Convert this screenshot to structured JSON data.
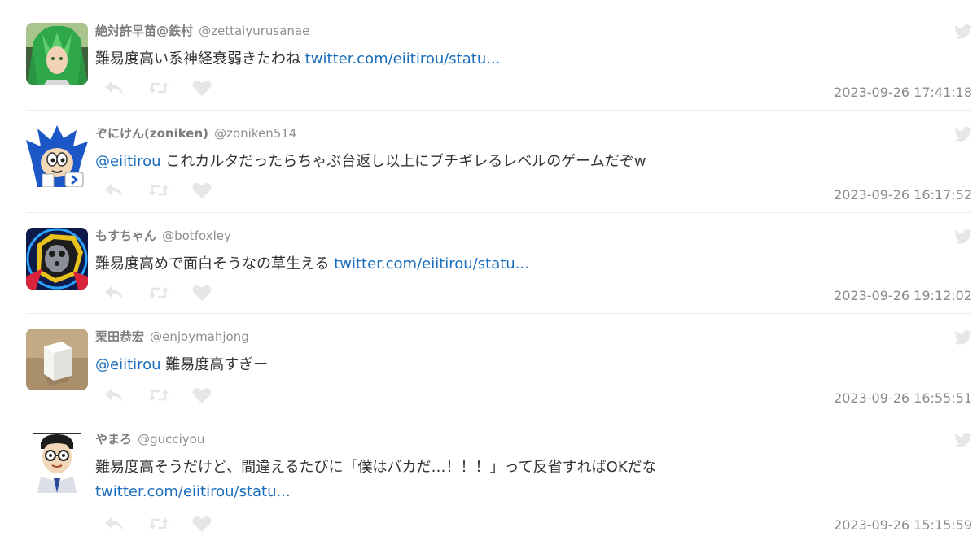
{
  "tweets": [
    {
      "display_name": "絶対許早苗@鉄村",
      "screen_name": "@zettaiyurusanae",
      "text": "難易度高い系神経衰弱きたわね ",
      "link": "twitter.com/eiitirou/statu...",
      "timestamp": "2023-09-26 17:41:18",
      "avatar": "green-haired-character-avatar"
    },
    {
      "display_name": "ぞにけん(zoniken)",
      "screen_name": "@zoniken514",
      "mention": "@eiitirou",
      "text": " これカルタだったらちゃぶ台返し以上にブチギレるレベルのゲームだぞw",
      "timestamp": "2023-09-26 16:17:52",
      "avatar": "blue-hedgehog-avatar"
    },
    {
      "display_name": "もすちゃん",
      "screen_name": "@botfoxley",
      "text": "難易度高めで面白そうなの草生える ",
      "link": "twitter.com/eiitirou/statu...",
      "timestamp": "2023-09-26 19:12:02",
      "avatar": "robot-mask-avatar"
    },
    {
      "display_name": "栗田恭宏",
      "screen_name": "@enjoymahjong",
      "mention": "@eiitirou",
      "text": " 難易度高すぎー",
      "timestamp": "2023-09-26 16:55:51",
      "avatar": "mahjong-tile-avatar"
    },
    {
      "display_name": "やまろ",
      "screen_name": "@gucciyou",
      "text": "難易度高そうだけど、間違えるたびに「僕はバカだ…！！！」って反省すればOKだな",
      "link": "twitter.com/eiitirou/statu...",
      "timestamp": "2023-09-26 15:15:59",
      "avatar": "glasses-man-avatar"
    }
  ],
  "colors": {
    "link": "#1a6ebd",
    "name": "#7c7c7c",
    "text": "#333333",
    "icon": "#e6e6e6"
  },
  "icons": [
    "reply-icon",
    "retweet-icon",
    "like-icon",
    "twitter-bird-icon"
  ]
}
